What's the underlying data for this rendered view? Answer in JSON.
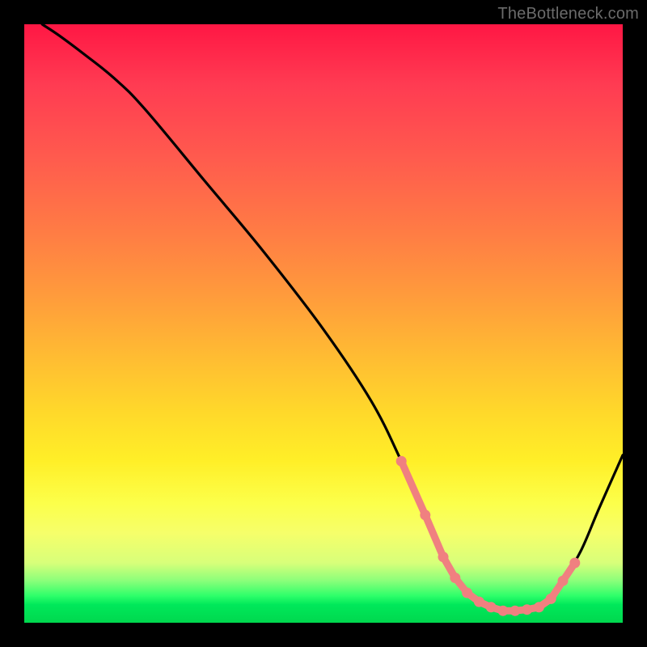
{
  "watermark": "TheBottleneck.com",
  "chart_data": {
    "type": "line",
    "title": "",
    "xlabel": "",
    "ylabel": "",
    "xlim": [
      0,
      100
    ],
    "ylim": [
      0,
      100
    ],
    "grid": false,
    "series": [
      {
        "name": "curve",
        "x": [
          3,
          6,
          10,
          15,
          20,
          30,
          40,
          50,
          58,
          63,
          67,
          70,
          73,
          77,
          80,
          83,
          86,
          88,
          90,
          93,
          96,
          100
        ],
        "y": [
          100,
          98,
          95,
          91,
          86,
          74,
          62,
          49,
          37,
          27,
          18,
          11,
          6,
          3,
          2,
          2,
          2.5,
          4,
          7,
          12,
          19,
          28
        ]
      }
    ],
    "markers": {
      "name": "highlight-dots",
      "color": "#f08080",
      "x": [
        63,
        67,
        70,
        72,
        74,
        76,
        78,
        80,
        82,
        84,
        86,
        88,
        90,
        92
      ],
      "y": [
        27,
        18,
        11,
        7.5,
        5,
        3.5,
        2.6,
        2,
        2,
        2.2,
        2.6,
        4,
        7,
        10
      ]
    },
    "background_gradient": {
      "direction": "vertical",
      "stops": [
        {
          "pos": 0.0,
          "color": "#ff1744"
        },
        {
          "pos": 0.45,
          "color": "#ff9a3c"
        },
        {
          "pos": 0.73,
          "color": "#ffef28"
        },
        {
          "pos": 0.95,
          "color": "#2eff6a"
        },
        {
          "pos": 1.0,
          "color": "#00d84e"
        }
      ]
    }
  }
}
